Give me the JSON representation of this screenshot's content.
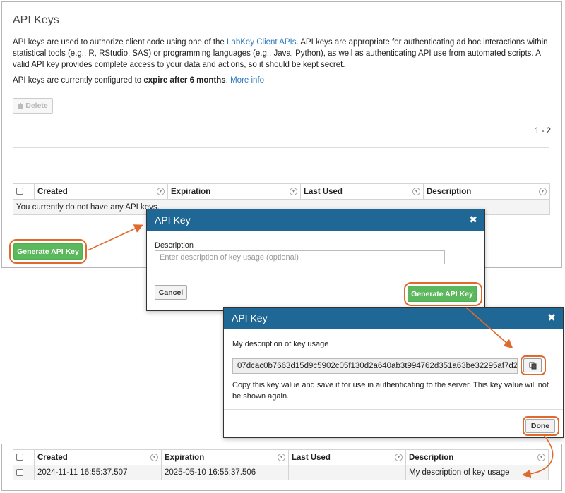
{
  "page": {
    "title": "API Keys",
    "intro_1": "API keys are used to authorize client code using one of the ",
    "intro_link": "LabKey Client APIs",
    "intro_2": ". API keys are appropriate for authenticating ad hoc interactions within statistical tools (e.g., R, RStudio, SAS) or programming languages (e.g., Java, Python), as well as authenticating API use from automated scripts. A valid API key provides complete access to your data and actions, so it should be kept secret.",
    "expire_prefix": "API keys are currently configured to ",
    "expire_bold": "expire after 6 months",
    "expire_suffix": ". ",
    "more_info": "More info",
    "delete_label": "Delete",
    "pager": "1 - 2",
    "generate_label": "Generate API Key"
  },
  "table": {
    "columns": [
      "Created",
      "Expiration",
      "Last Used",
      "Description"
    ],
    "empty_message": "You currently do not have any API keys."
  },
  "dialog_create": {
    "title": "API Key",
    "description_label": "Description",
    "description_placeholder": "Enter description of key usage (optional)",
    "cancel_label": "Cancel",
    "generate_label": "Generate API Key"
  },
  "dialog_result": {
    "title": "API Key",
    "description": "My description of key usage",
    "key_value": "07dcac0b7663d15d9c5902c05f130d2a640ab3t994762d351a63be32295af7d2",
    "note": "Copy this key value and save it for use in authenticating to the server. This key value will not be shown again.",
    "done_label": "Done"
  },
  "result_table": {
    "columns": [
      "Created",
      "Expiration",
      "Last Used",
      "Description"
    ],
    "rows": [
      {
        "created": "2024-11-11 16:55:37.507",
        "expiration": "2025-05-10 16:55:37.506",
        "last_used": "",
        "description": "My description of key usage"
      }
    ]
  },
  "colors": {
    "header_blue": "#1f6794",
    "button_green": "#5cb85c",
    "callout_orange": "#e06a2c",
    "link_blue": "#2f7bbf"
  },
  "icons": {
    "delete": "trash-icon",
    "close": "close-icon",
    "copy": "copy-icon",
    "sort": "chevron-down-icon"
  }
}
